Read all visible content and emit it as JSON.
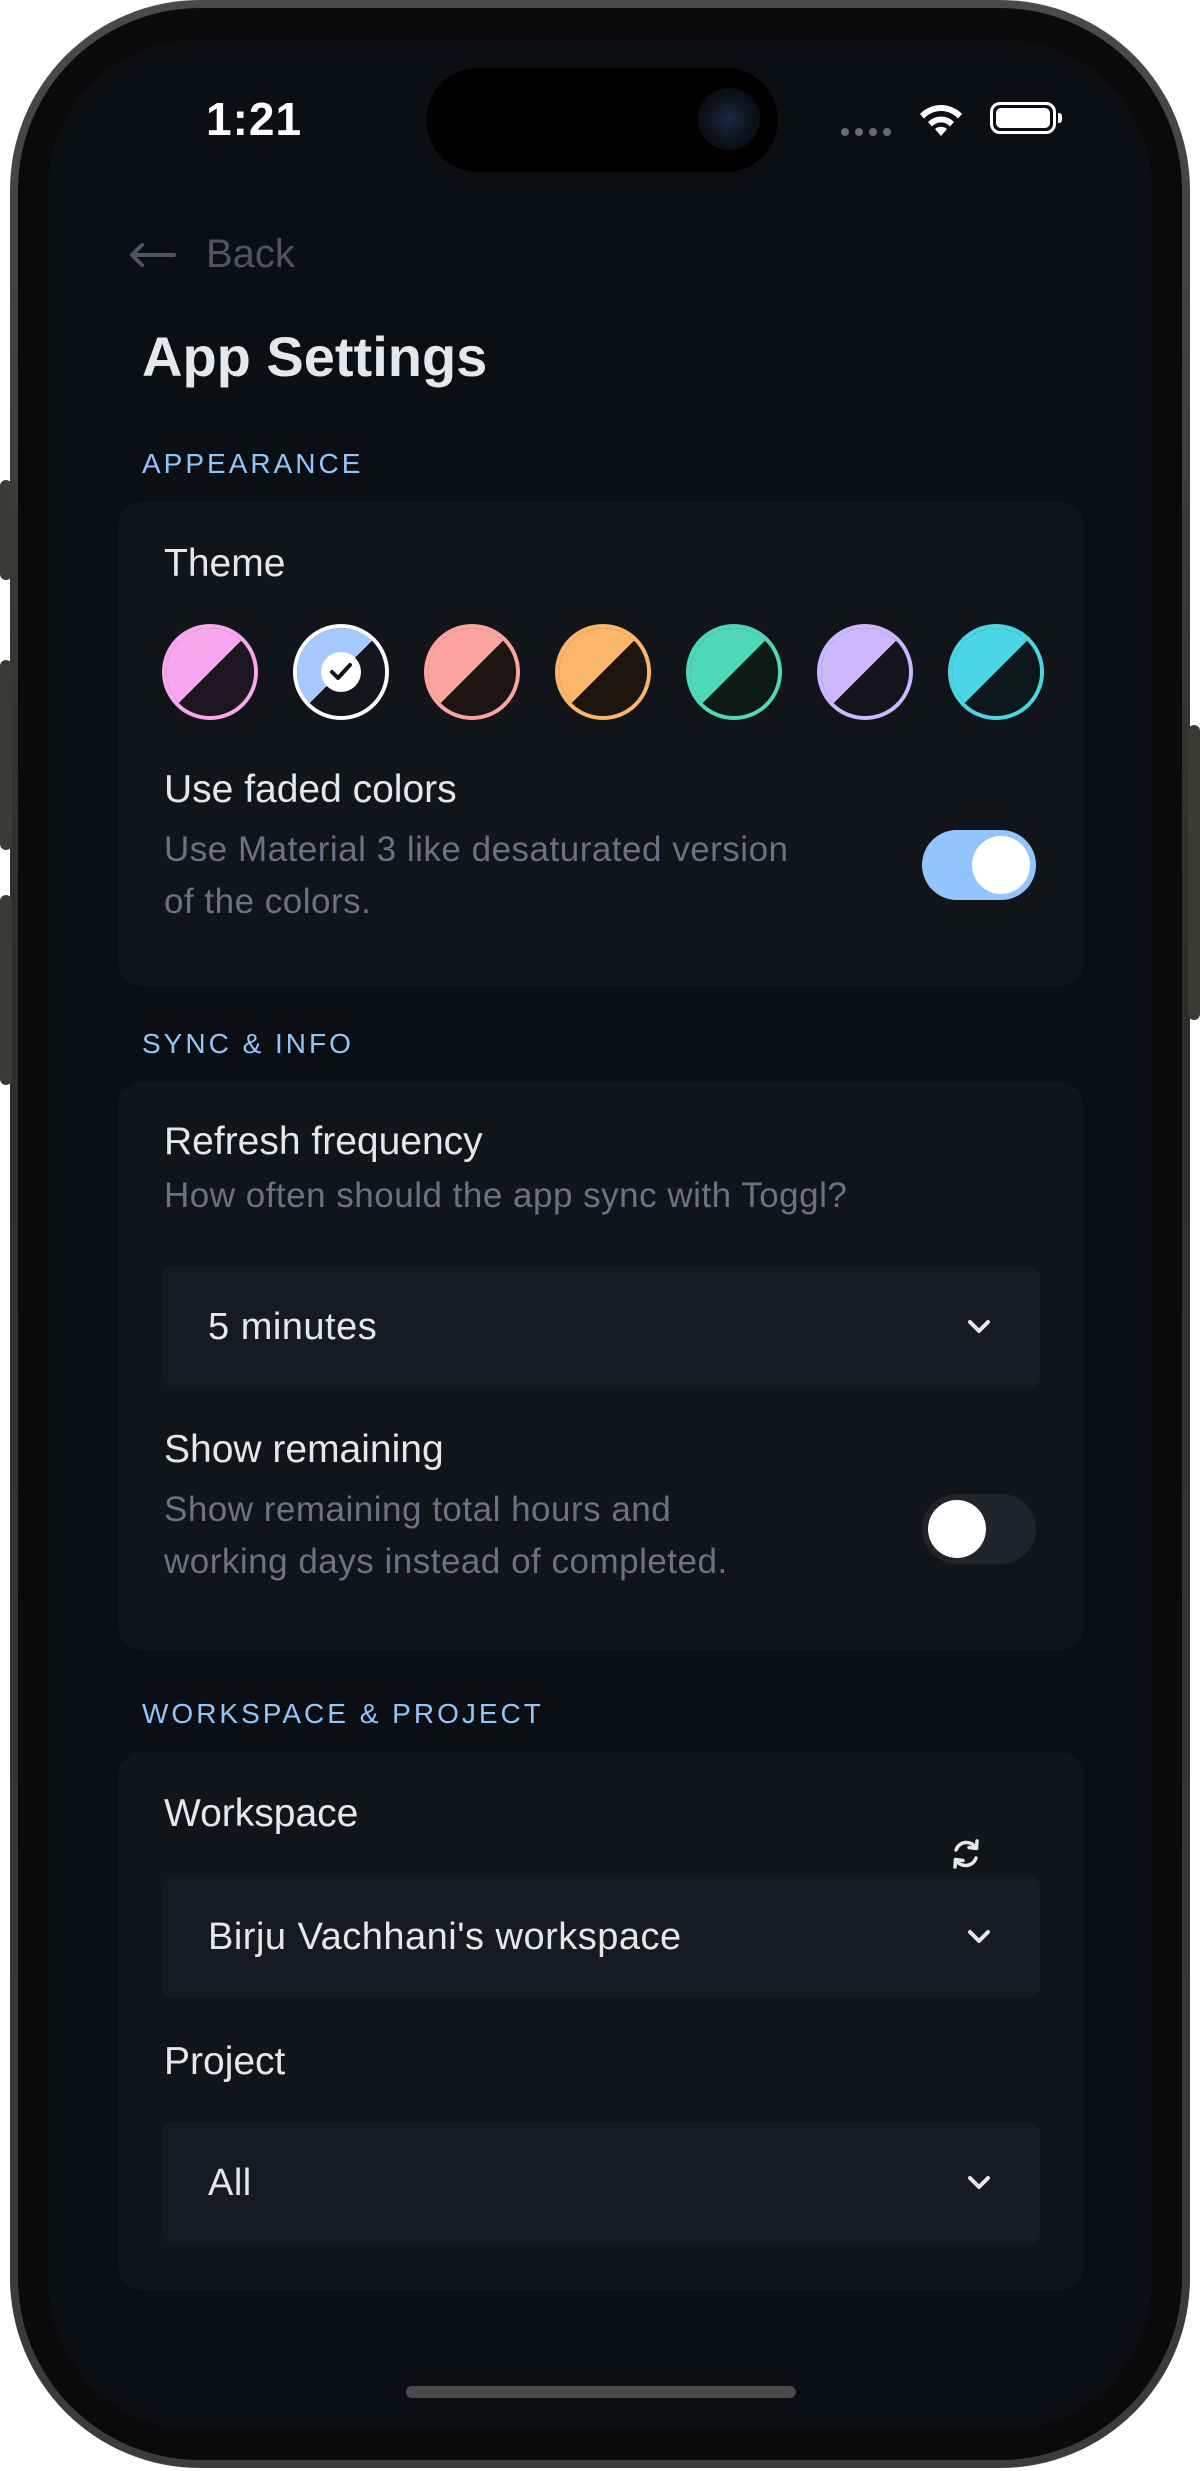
{
  "status_bar": {
    "time": "1:21"
  },
  "nav": {
    "back_label": "Back"
  },
  "page": {
    "title": "App Settings"
  },
  "appearance": {
    "section_label": "APPEARANCE",
    "theme_label": "Theme",
    "themes": [
      {
        "name": "pink",
        "light": "#f9a8f0",
        "dark": "#1d1520",
        "ring": "#f9a8f0",
        "selected": false
      },
      {
        "name": "blue",
        "light": "#a5c8ff",
        "dark": "#12151c",
        "ring": "#ffffff",
        "selected": true
      },
      {
        "name": "salmon",
        "light": "#fca5a0",
        "dark": "#1d1414",
        "ring": "#fca5a0",
        "selected": false
      },
      {
        "name": "orange",
        "light": "#fdb56a",
        "dark": "#1c1510",
        "ring": "#fdb56a",
        "selected": false
      },
      {
        "name": "teal",
        "light": "#4fd8b8",
        "dark": "#0d1a18",
        "ring": "#4fd8b8",
        "selected": false
      },
      {
        "name": "lavender",
        "light": "#cdb8ff",
        "dark": "#15131c",
        "ring": "#cdb8ff",
        "selected": false
      },
      {
        "name": "cyan",
        "light": "#4bd6e6",
        "dark": "#0d181b",
        "ring": "#4bd6e6",
        "selected": false
      }
    ],
    "faded": {
      "label": "Use faded colors",
      "desc_line1": "Use Material 3 like desaturated version",
      "desc_line2": "of the colors.",
      "on": true
    }
  },
  "sync": {
    "section_label": "SYNC & INFO",
    "refresh": {
      "label": "Refresh frequency",
      "desc": "How often should the app sync with Toggl?",
      "value": "5 minutes"
    },
    "remaining": {
      "label": "Show remaining",
      "desc_line1": "Show remaining total hours and",
      "desc_line2": "working days instead of completed.",
      "on": false
    }
  },
  "workspace": {
    "section_label": "WORKSPACE & PROJECT",
    "workspace_label": "Workspace",
    "workspace_value": "Birju Vachhani's workspace",
    "project_label": "Project",
    "project_value": "All"
  },
  "colors": {
    "accent": "#93c5fd",
    "toggle_on": "#93c5fd",
    "toggle_off": "#1f242b",
    "background": "#0b0f14",
    "card": "#111519"
  }
}
